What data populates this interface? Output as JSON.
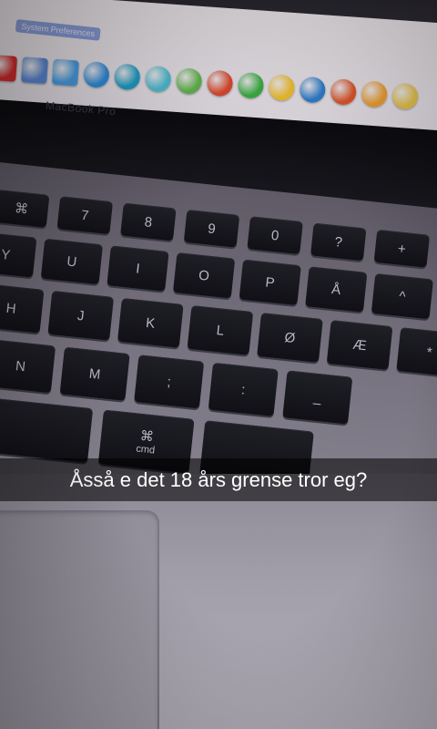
{
  "photo": {
    "screen_title": "System Preferences",
    "brand": "MacBook Pro",
    "keys": {
      "row1": [
        "⌘",
        "7",
        "8",
        "9",
        "0",
        "?",
        "+"
      ],
      "row2": [
        "Y",
        "U",
        "I",
        "O",
        "P",
        "Å",
        "^"
      ],
      "row3": [
        "H",
        "J",
        "K",
        "L",
        "Ø",
        "Æ",
        "*"
      ],
      "row4": [
        "N",
        "M",
        ";",
        ":",
        "_"
      ],
      "cmd_label": "⌘",
      "cmd_word": "cmd"
    },
    "dock_colors": [
      "#d62d2d",
      "#5a8ad6",
      "#4aa0e6",
      "#2f8fe0",
      "#1da0c9",
      "#4ec0d6",
      "#63b84f",
      "#e04a2f",
      "#3cb043",
      "#f2c12e",
      "#2f7fd0",
      "#e0572a",
      "#f0a030",
      "#e8c44a"
    ]
  },
  "caption": {
    "text": "Åsså e det 18 års grense tror eg?"
  }
}
